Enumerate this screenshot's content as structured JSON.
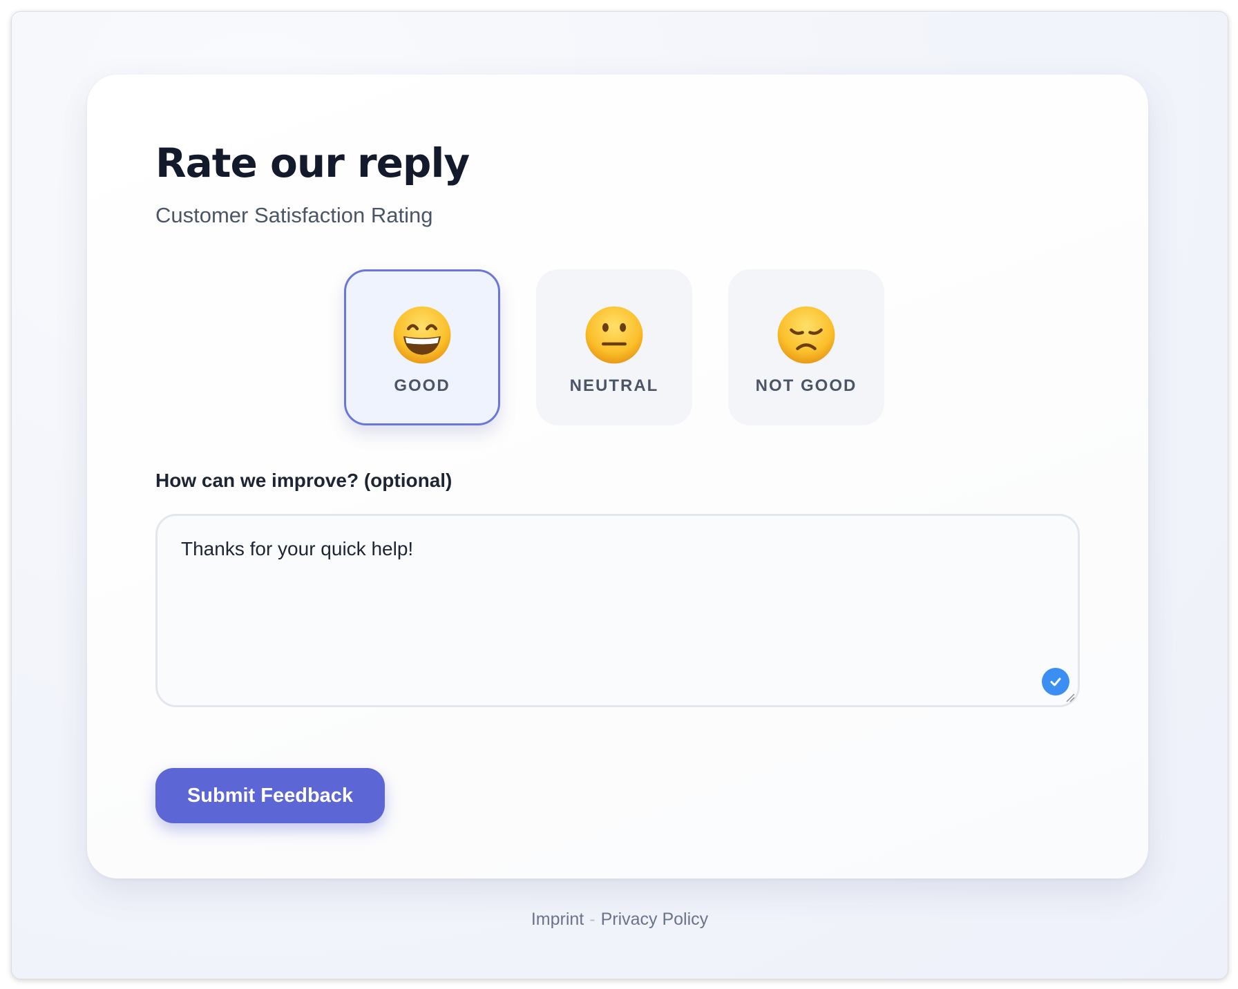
{
  "page": {
    "title": "Rate our reply",
    "subtitle": "Customer Satisfaction Rating"
  },
  "rating": {
    "selected": "good",
    "options": [
      {
        "id": "good",
        "label": "GOOD",
        "icon": "grinning-face-icon"
      },
      {
        "id": "neutral",
        "label": "NEUTRAL",
        "icon": "neutral-face-icon"
      },
      {
        "id": "not_good",
        "label": "NOT GOOD",
        "icon": "disappointed-face-icon"
      }
    ]
  },
  "feedback": {
    "label": "How can we improve? (optional)",
    "value": "Thanks for your quick help!",
    "status_icon": "checkmark-icon"
  },
  "submit": {
    "label": "Submit Feedback"
  },
  "footer": {
    "imprint": "Imprint",
    "separator": "-",
    "privacy": "Privacy Policy"
  },
  "colors": {
    "accent": "#5c66d4",
    "selected_border": "#6b76db",
    "check": "#3b8ff2",
    "title": "#121a2b"
  }
}
